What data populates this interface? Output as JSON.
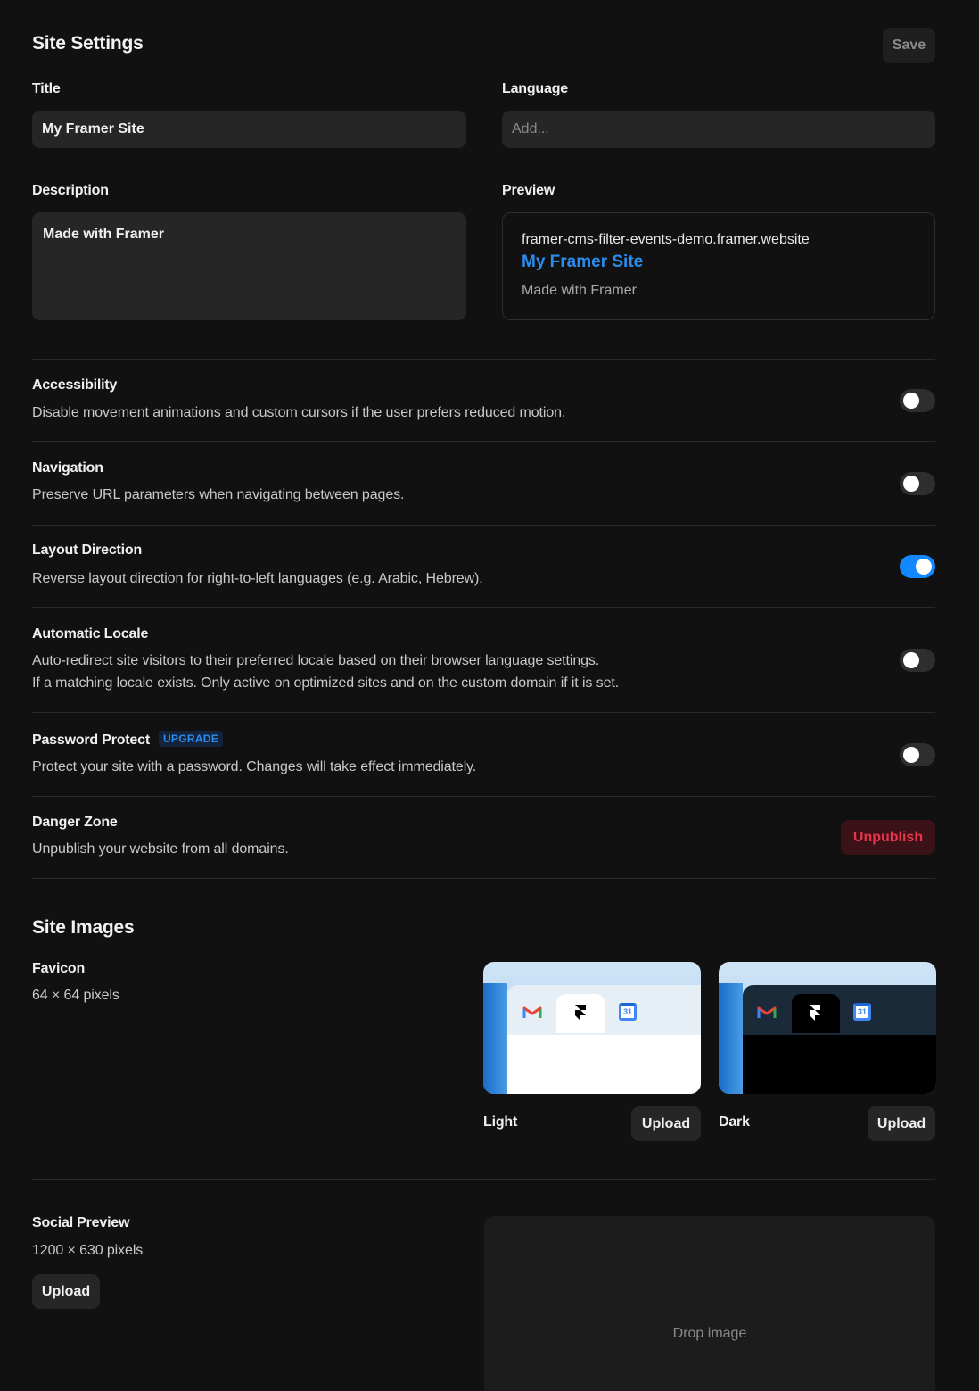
{
  "header": {
    "title": "Site Settings",
    "save_label": "Save"
  },
  "fields": {
    "title_label": "Title",
    "title_value": "My Framer Site",
    "language_label": "Language",
    "language_placeholder": "Add...",
    "description_label": "Description",
    "description_value": "Made with Framer",
    "preview_label": "Preview"
  },
  "preview": {
    "url": "framer-cms-filter-events-demo.framer.website",
    "title": "My Framer Site",
    "description": "Made with Framer"
  },
  "settings": [
    {
      "title": "Accessibility",
      "desc": [
        "Disable movement animations and custom cursors if the user prefers reduced motion."
      ],
      "enabled": false
    },
    {
      "title": "Navigation",
      "desc": [
        "Preserve URL parameters when navigating between pages."
      ],
      "enabled": false
    },
    {
      "title": "Layout Direction",
      "desc": [
        "Reverse layout direction for right-to-left languages (e.g. Arabic, Hebrew)."
      ],
      "enabled": true
    },
    {
      "title": "Automatic Locale",
      "desc": [
        "Auto-redirect site visitors to their preferred locale based on their browser language settings.",
        "If a matching locale exists. Only active on optimized sites and on the custom domain if it is set."
      ],
      "enabled": false
    },
    {
      "title": "Password Protect",
      "badge": "UPGRADE",
      "desc": [
        "Protect your site with a password. Changes will take effect immediately."
      ],
      "enabled": false
    }
  ],
  "danger": {
    "title": "Danger Zone",
    "desc": "Unpublish your website from all domains.",
    "button": "Unpublish"
  },
  "site_images": {
    "title": "Site Images",
    "favicon_label": "Favicon",
    "favicon_size": "64 × 64 pixels",
    "light_label": "Light",
    "dark_label": "Dark",
    "upload_label": "Upload",
    "calendar_day": "31",
    "social_label": "Social Preview",
    "social_size": "1200 × 630 pixels",
    "drop_text": "Drop image"
  },
  "colors": {
    "accent": "#1188ff",
    "danger": "#e8334b",
    "background": "#111111"
  }
}
